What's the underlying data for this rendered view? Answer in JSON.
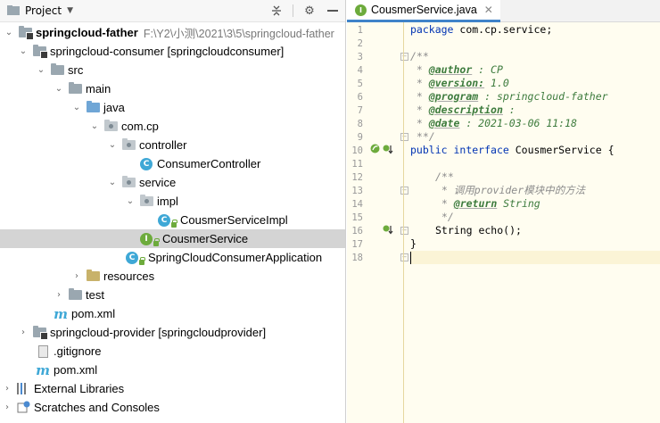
{
  "project_panel": {
    "title": "Project",
    "tree": [
      {
        "label": "springcloud-father",
        "suffix": "F:\\Y2\\小测\\2021\\3\\5\\springcloud-father",
        "icon": "module-folder-icon",
        "arrow": "v"
      },
      {
        "label": "springcloud-consumer [springcloudconsumer]",
        "icon": "module-folder-icon",
        "arrow": "v"
      },
      {
        "label": "src",
        "icon": "folder-icon",
        "arrow": "v"
      },
      {
        "label": "main",
        "icon": "folder-icon",
        "arrow": "v"
      },
      {
        "label": "java",
        "icon": "source-folder-icon",
        "arrow": "v"
      },
      {
        "label": "com.cp",
        "icon": "package-icon",
        "arrow": "v"
      },
      {
        "label": "controller",
        "icon": "package-icon",
        "arrow": "v"
      },
      {
        "label": "ConsumerController",
        "icon": "class-icon",
        "arrow": ""
      },
      {
        "label": "service",
        "icon": "package-icon",
        "arrow": "v"
      },
      {
        "label": "impl",
        "icon": "package-icon",
        "arrow": "v"
      },
      {
        "label": "CousmerServiceImpl",
        "icon": "class-icon",
        "arrow": ""
      },
      {
        "label": "CousmerService",
        "icon": "interface-icon",
        "arrow": ""
      },
      {
        "label": "SpringCloudConsumerApplication",
        "icon": "spring-class-icon",
        "arrow": ""
      },
      {
        "label": "resources",
        "icon": "resources-folder-icon",
        "arrow": ">"
      },
      {
        "label": "test",
        "icon": "folder-icon",
        "arrow": ">"
      },
      {
        "label": "pom.xml",
        "icon": "maven-icon",
        "arrow": ""
      },
      {
        "label": "springcloud-provider [springcloudprovider]",
        "icon": "module-folder-icon",
        "arrow": ">"
      },
      {
        "label": ".gitignore",
        "icon": "file-icon",
        "arrow": ""
      },
      {
        "label": "pom.xml",
        "icon": "maven-icon",
        "arrow": ""
      },
      {
        "label": "External Libraries",
        "icon": "libraries-icon",
        "arrow": ">"
      },
      {
        "label": "Scratches and Consoles",
        "icon": "scratches-icon",
        "arrow": ">"
      }
    ]
  },
  "editor": {
    "tab_label": "CousmerService.java",
    "line_numbers": [
      "1",
      "2",
      "3",
      "4",
      "5",
      "6",
      "7",
      "8",
      "9",
      "10",
      "11",
      "12",
      "13",
      "14",
      "15",
      "16",
      "17",
      "18"
    ],
    "code": {
      "l1_kw": "package",
      "l1_rest": " com.cp.service;",
      "l3": "/**",
      "l4_tag": "@author",
      "l4_val": " : CP",
      "l5_tag": "@version:",
      "l5_val": " 1.0",
      "l6_tag": "@program",
      "l6_val": " : springcloud-father",
      "l7_tag": "@description",
      "l7_val": " :",
      "l8_tag": "@date",
      "l8_val": " : 2021-03-06 11:18",
      "l9": " **/",
      "l10_kw1": "public",
      "l10_kw2": "interface",
      "l10_rest": " CousmerService {",
      "l13": "/**",
      "l14": " * 调用provider模块中的方法",
      "l15_tag": "@return",
      "l15_val": " String",
      "l16": " */",
      "l17": "String echo();",
      "l18": "}"
    }
  }
}
